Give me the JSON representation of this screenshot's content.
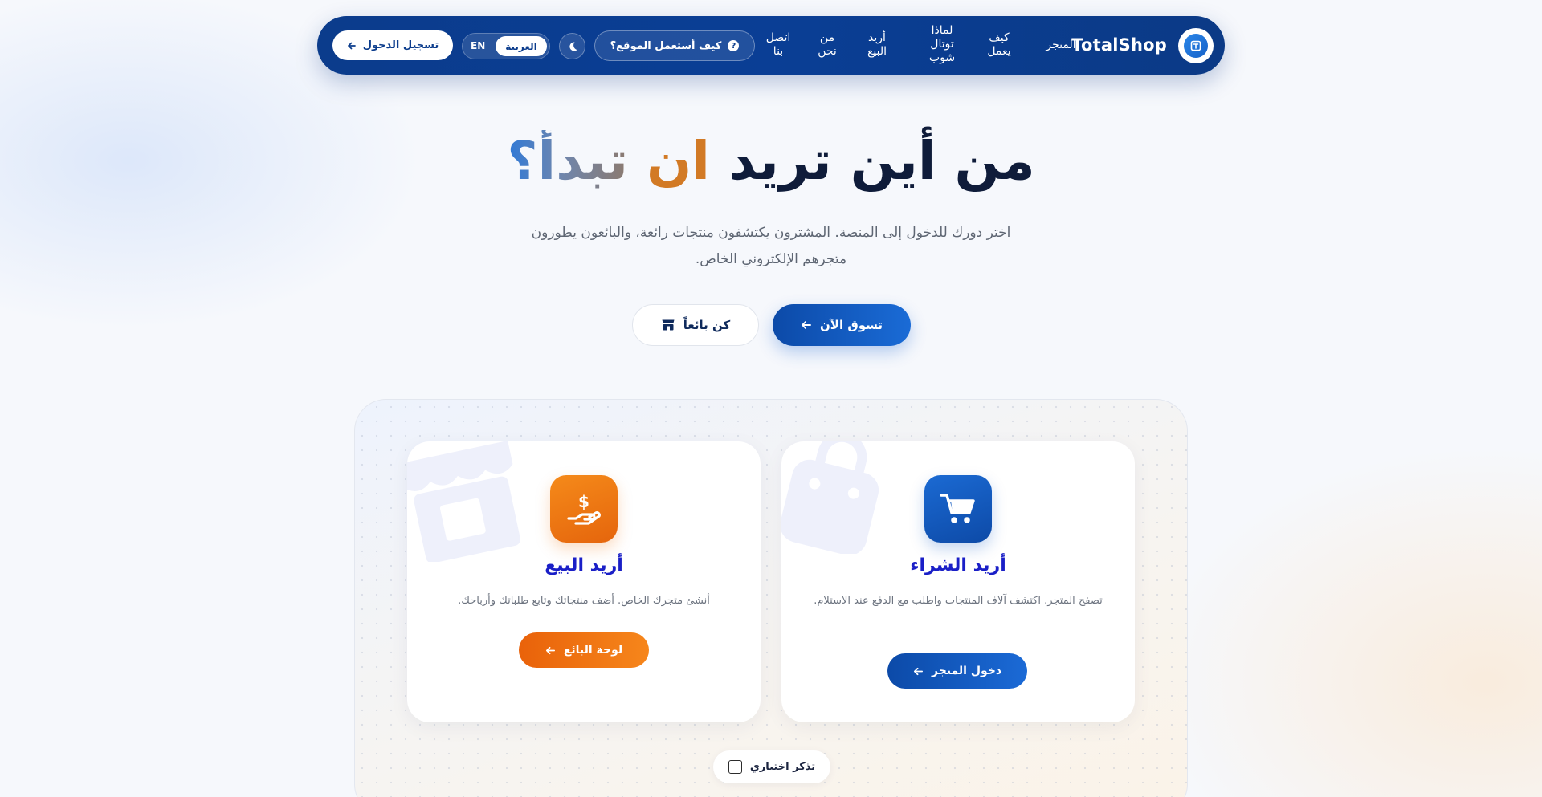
{
  "nav": {
    "brand": "TotalShop",
    "links": {
      "store": "المتجر",
      "how_it_works": "كيف يعمل",
      "why_totalshop": "لماذا توتال شوب",
      "want_to_sell": "أريد البيع",
      "about_us": "من نحن",
      "contact_us": "اتصل بنا"
    },
    "help_label": "كيف أستعمل الموقع؟",
    "help_icon": "question-icon",
    "theme_icon": "moon-icon",
    "language": {
      "arabic": "العربية",
      "english": "EN",
      "selected": "العربية"
    },
    "login_label": "تسجيل الدخول",
    "colors": {
      "bar": "#0b3c8c"
    }
  },
  "hero": {
    "title_part1": "من أين تريد",
    "title_part2": "ان",
    "title_part3": "تبدأ؟",
    "subtitle": "اختر دورك للدخول إلى المنصة. المشترون يكتشفون منتجات رائعة، والبائعون يطورون متجرهم الإلكتروني الخاص.",
    "shop_now_label": "تسوق الآن",
    "become_seller_label": "كن بائعاً",
    "colors": {
      "dark": "#0f1c3a",
      "orange": "#d27a25",
      "blue": "#1a6bd6"
    }
  },
  "cards": {
    "buy": {
      "title": "أريد الشراء",
      "description": "تصفح المتجر. اكتشف آلاف المنتجات واطلب مع الدفع عند الاستلام.",
      "button_label": "دخول المتجر",
      "icon": "cart-icon",
      "accent": "#0d4aa7"
    },
    "sell": {
      "title": "أريد البيع",
      "description": "أنشئ متجرك الخاص. أضف منتجاتك وتابع طلباتك وأرباحك.",
      "button_label": "لوحة البائع",
      "icon": "hand-dollar-icon",
      "accent": "#f07415"
    }
  },
  "remember_choice_label": "تذكر اختياري",
  "remember_choice_checked": false
}
